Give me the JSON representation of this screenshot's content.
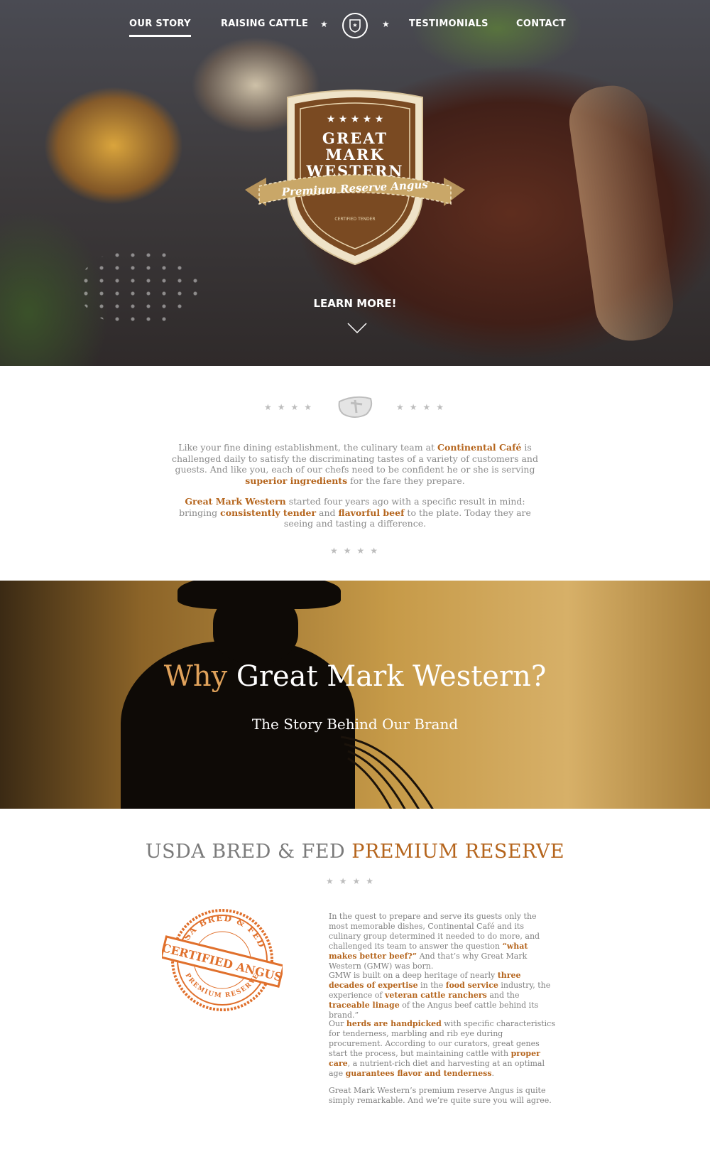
{
  "nav": {
    "items": [
      "OUR STORY",
      "RAISING CATTLE",
      "TESTIMONIALS",
      "CONTACT"
    ],
    "active": "OUR STORY"
  },
  "badge": {
    "line1": "GREAT",
    "line2": "MARK",
    "line3": "WESTERN",
    "ribbon": "Premium Reserve Angus",
    "small": "CERTIFIED TENDER"
  },
  "hero": {
    "cta": "LEARN MORE!"
  },
  "intro": {
    "p1": [
      {
        "t": "Like your fine dining establishment, the culinary team at ",
        "h": false
      },
      {
        "t": "Continental Café",
        "h": true
      },
      {
        "t": " is challenged daily to satisfy the discriminating tastes of a variety of customers and guests. And like you, each of our chefs need to be confident he or she is serving ",
        "h": false
      },
      {
        "t": "superior ingredients",
        "h": true
      },
      {
        "t": " for the fare they prepare.",
        "h": false
      }
    ],
    "p2": [
      {
        "t": "Great Mark Western",
        "h": true
      },
      {
        "t": " started four years ago with a specific result in mind: bringing ",
        "h": false
      },
      {
        "t": "consistently tender",
        "h": true
      },
      {
        "t": " and ",
        "h": false
      },
      {
        "t": "flavorful beef",
        "h": true
      },
      {
        "t": " to the plate. Today they are seeing and tasting a difference.",
        "h": false
      }
    ]
  },
  "why": {
    "title_accent": "Why",
    "title_rest": "Great Mark Western?",
    "subtitle": "The Story Behind Our Brand"
  },
  "usda": {
    "title_plain": "USDA BRED & FED",
    "title_accent": "PREMIUM RESERVE",
    "stamp": {
      "top": "USA BRED & FED",
      "middle": "CERTIFIED ANGUS",
      "bottom": "PREMIUM RESERVE"
    },
    "paragraphs": [
      [
        {
          "t": "In the quest to prepare and serve its guests only the most memorable dishes, Continental Café and its culinary group determined it needed to do more, and challenged its team to answer the question ",
          "h": false
        },
        {
          "t": "“what makes better beef?”",
          "h": true
        },
        {
          "t": " And that’s why Great Mark Western (GMW) was born.",
          "h": false
        }
      ],
      [
        {
          "t": "GMW is built on a deep heritage of nearly ",
          "h": false
        },
        {
          "t": "three decades of expertise",
          "h": true
        },
        {
          "t": " in the ",
          "h": false
        },
        {
          "t": "food service",
          "h": true
        },
        {
          "t": " industry, the experience of ",
          "h": false
        },
        {
          "t": "veteran cattle ranchers",
          "h": true
        },
        {
          "t": " and the ",
          "h": false
        },
        {
          "t": "traceable linage",
          "h": true
        },
        {
          "t": " of the Angus beef cattle behind its brand.”",
          "h": false
        }
      ],
      [
        {
          "t": "Our ",
          "h": false
        },
        {
          "t": "herds are handpicked",
          "h": true
        },
        {
          "t": " with specific characteristics for tenderness, marbling and rib eye during procurement. According to our curators, great genes start the process, but maintaining cattle with ",
          "h": false
        },
        {
          "t": "proper care",
          "h": true
        },
        {
          "t": ", a nutrient-rich diet and harvesting at an optimal age ",
          "h": false
        },
        {
          "t": "guarantees flavor and tenderness",
          "h": true
        },
        {
          "t": ".",
          "h": false
        }
      ],
      [
        {
          "t": "Great Mark Western’s premium reserve Angus is quite simply remarkable. And we’re quite sure you will agree.",
          "h": false
        }
      ]
    ]
  },
  "colors": {
    "accent": "#b5651d",
    "badge_brown": "#7a4a22",
    "ribbon_gold": "#c9a768",
    "stamp_orange": "#e0702c"
  }
}
